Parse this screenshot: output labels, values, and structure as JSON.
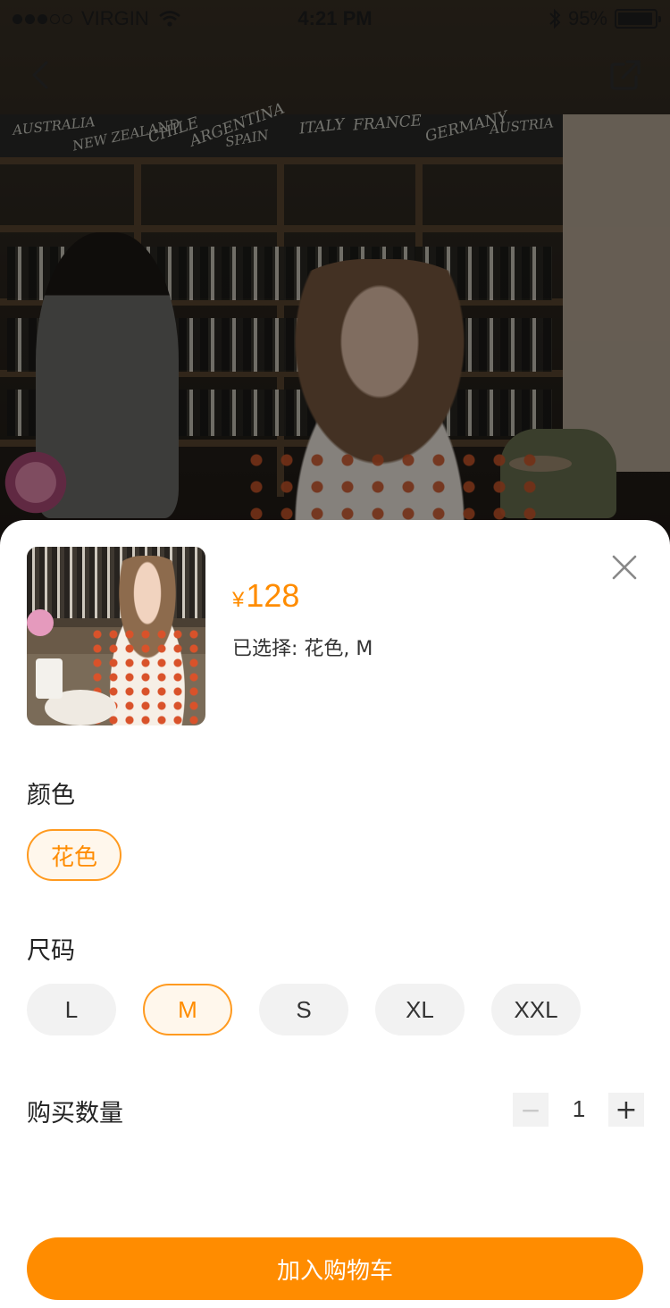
{
  "status_bar": {
    "carrier": "VIRGIN",
    "time": "4:21 PM",
    "battery": "95%",
    "battery_level": 0.95,
    "signal_bars_on": 3,
    "signal_bars_total": 5
  },
  "nav": {
    "back_icon": "chevron-left-icon",
    "share_icon": "share-external-icon"
  },
  "hero": {
    "board_words": [
      "AUSTRALIA",
      "NEW ZEALAND",
      "CHILE",
      "ARGENTINA",
      "SPAIN",
      "ITALY",
      "FRANCE",
      "GERMANY",
      "AUSTRIA"
    ]
  },
  "product": {
    "currency": "¥",
    "price": "128",
    "selected_text": "已选择: 花色, M"
  },
  "color_section": {
    "title": "颜色",
    "options": [
      {
        "label": "花色",
        "selected": true
      }
    ]
  },
  "size_section": {
    "title": "尺码",
    "options": [
      {
        "label": "L",
        "selected": false
      },
      {
        "label": "M",
        "selected": true
      },
      {
        "label": "S",
        "selected": false
      },
      {
        "label": "XL",
        "selected": false
      },
      {
        "label": "XXL",
        "selected": false
      }
    ]
  },
  "quantity_section": {
    "title": "购买数量",
    "value": "1",
    "minus_symbol": "−",
    "plus_symbol": "+"
  },
  "cart_button": {
    "label": "加入购物车"
  },
  "colors": {
    "accent": "#ff8c00",
    "accent_border": "#ff9a1f",
    "chip_bg": "#f2f2f2"
  }
}
